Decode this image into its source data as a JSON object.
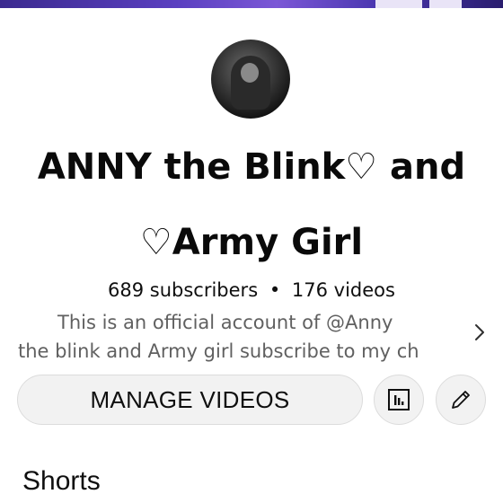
{
  "channel": {
    "name_line1": "ANNY the Blink♡ and",
    "name_line2": "♡Army Girl",
    "subscribers": "689 subscribers",
    "separator": "•",
    "videos": "176 videos",
    "description_line1": "This is an official account of @Anny",
    "description_line2": "the blink and Army girl subscribe to my ch"
  },
  "actions": {
    "manage_label": "MANAGE VIDEOS",
    "analytics_icon": "bar-chart-icon",
    "edit_icon": "pencil-icon"
  },
  "sections": {
    "shorts_title": "Shorts"
  },
  "colors": {
    "text_primary": "#0f0f0f",
    "text_secondary": "#606060",
    "button_bg": "#f2f2f2",
    "banner": "#5a3fc0"
  }
}
